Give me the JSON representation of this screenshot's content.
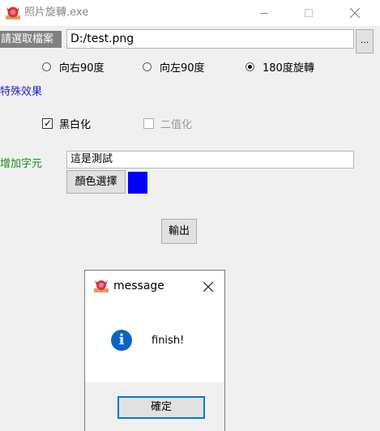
{
  "window": {
    "title": "照片旋轉.exe",
    "icon": "rose-app-icon"
  },
  "form": {
    "file_label": "請選取檔案",
    "file_path": "D:/test.png",
    "browse_label": "...",
    "rotation": {
      "options": [
        "向右90度",
        "向左90度",
        "180度旋轉"
      ],
      "selected": "180度旋轉"
    },
    "effects_heading": "特殊效果",
    "grayscale_label": "黑白化",
    "grayscale_checked": true,
    "binarize_label": "二值化",
    "binarize_checked": false,
    "binarize_enabled": false,
    "add_text_heading": "增加字元",
    "text_value": "這是測試",
    "color_button_label": "顏色選擇",
    "selected_color": "#0000ff",
    "export_button_label": "輸出"
  },
  "dialog": {
    "title": "message",
    "icon": "info-icon",
    "message": "finish!",
    "ok_label": "確定"
  },
  "colors": {
    "accent": "#0078d7",
    "effects_heading": "#2222cc",
    "add_text_heading": "#208a20",
    "swatch": "#0000ff"
  }
}
